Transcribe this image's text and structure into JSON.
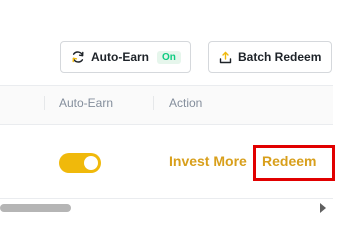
{
  "toolbar": {
    "auto_earn_label": "Auto-Earn",
    "auto_earn_status": "On",
    "batch_redeem_label": "Batch Redeem"
  },
  "table": {
    "columns": [
      "Auto-Earn",
      "Action"
    ],
    "row": {
      "auto_earn_enabled": true,
      "actions": [
        "Invest More",
        "Redeem"
      ]
    }
  },
  "colors": {
    "accent": "#f0b90b",
    "link": "#d89f1b",
    "badge_text": "#0ecb81",
    "highlight": "#e10000"
  },
  "icons": {
    "auto_earn": "refresh-icon",
    "batch_redeem": "upload-icon",
    "scroll_right": "scroll-right-arrow-icon"
  }
}
